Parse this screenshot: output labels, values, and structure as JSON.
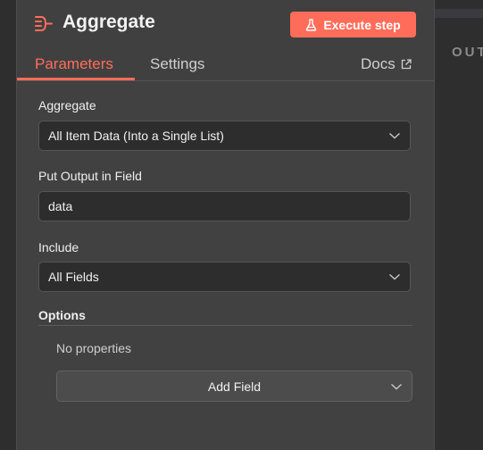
{
  "header": {
    "title": "Aggregate",
    "title_icon": "aggregate-icon",
    "execute_label": "Execute step",
    "execute_icon": "flask-icon"
  },
  "tabs": {
    "parameters": "Parameters",
    "settings": "Settings",
    "docs": "Docs",
    "docs_icon": "external-link-icon",
    "active": "parameters"
  },
  "output_panel": {
    "label": "OUT"
  },
  "form": {
    "aggregate": {
      "label": "Aggregate",
      "value": "All Item Data (Into a Single List)"
    },
    "put_output": {
      "label": "Put Output in Field",
      "value": "data"
    },
    "include": {
      "label": "Include",
      "value": "All Fields"
    },
    "options": {
      "label": "Options",
      "empty_text": "No properties",
      "add_label": "Add Field"
    }
  },
  "colors": {
    "accent": "#ff6d5a",
    "panel_bg": "#414141",
    "field_bg": "#2d2d2d"
  }
}
